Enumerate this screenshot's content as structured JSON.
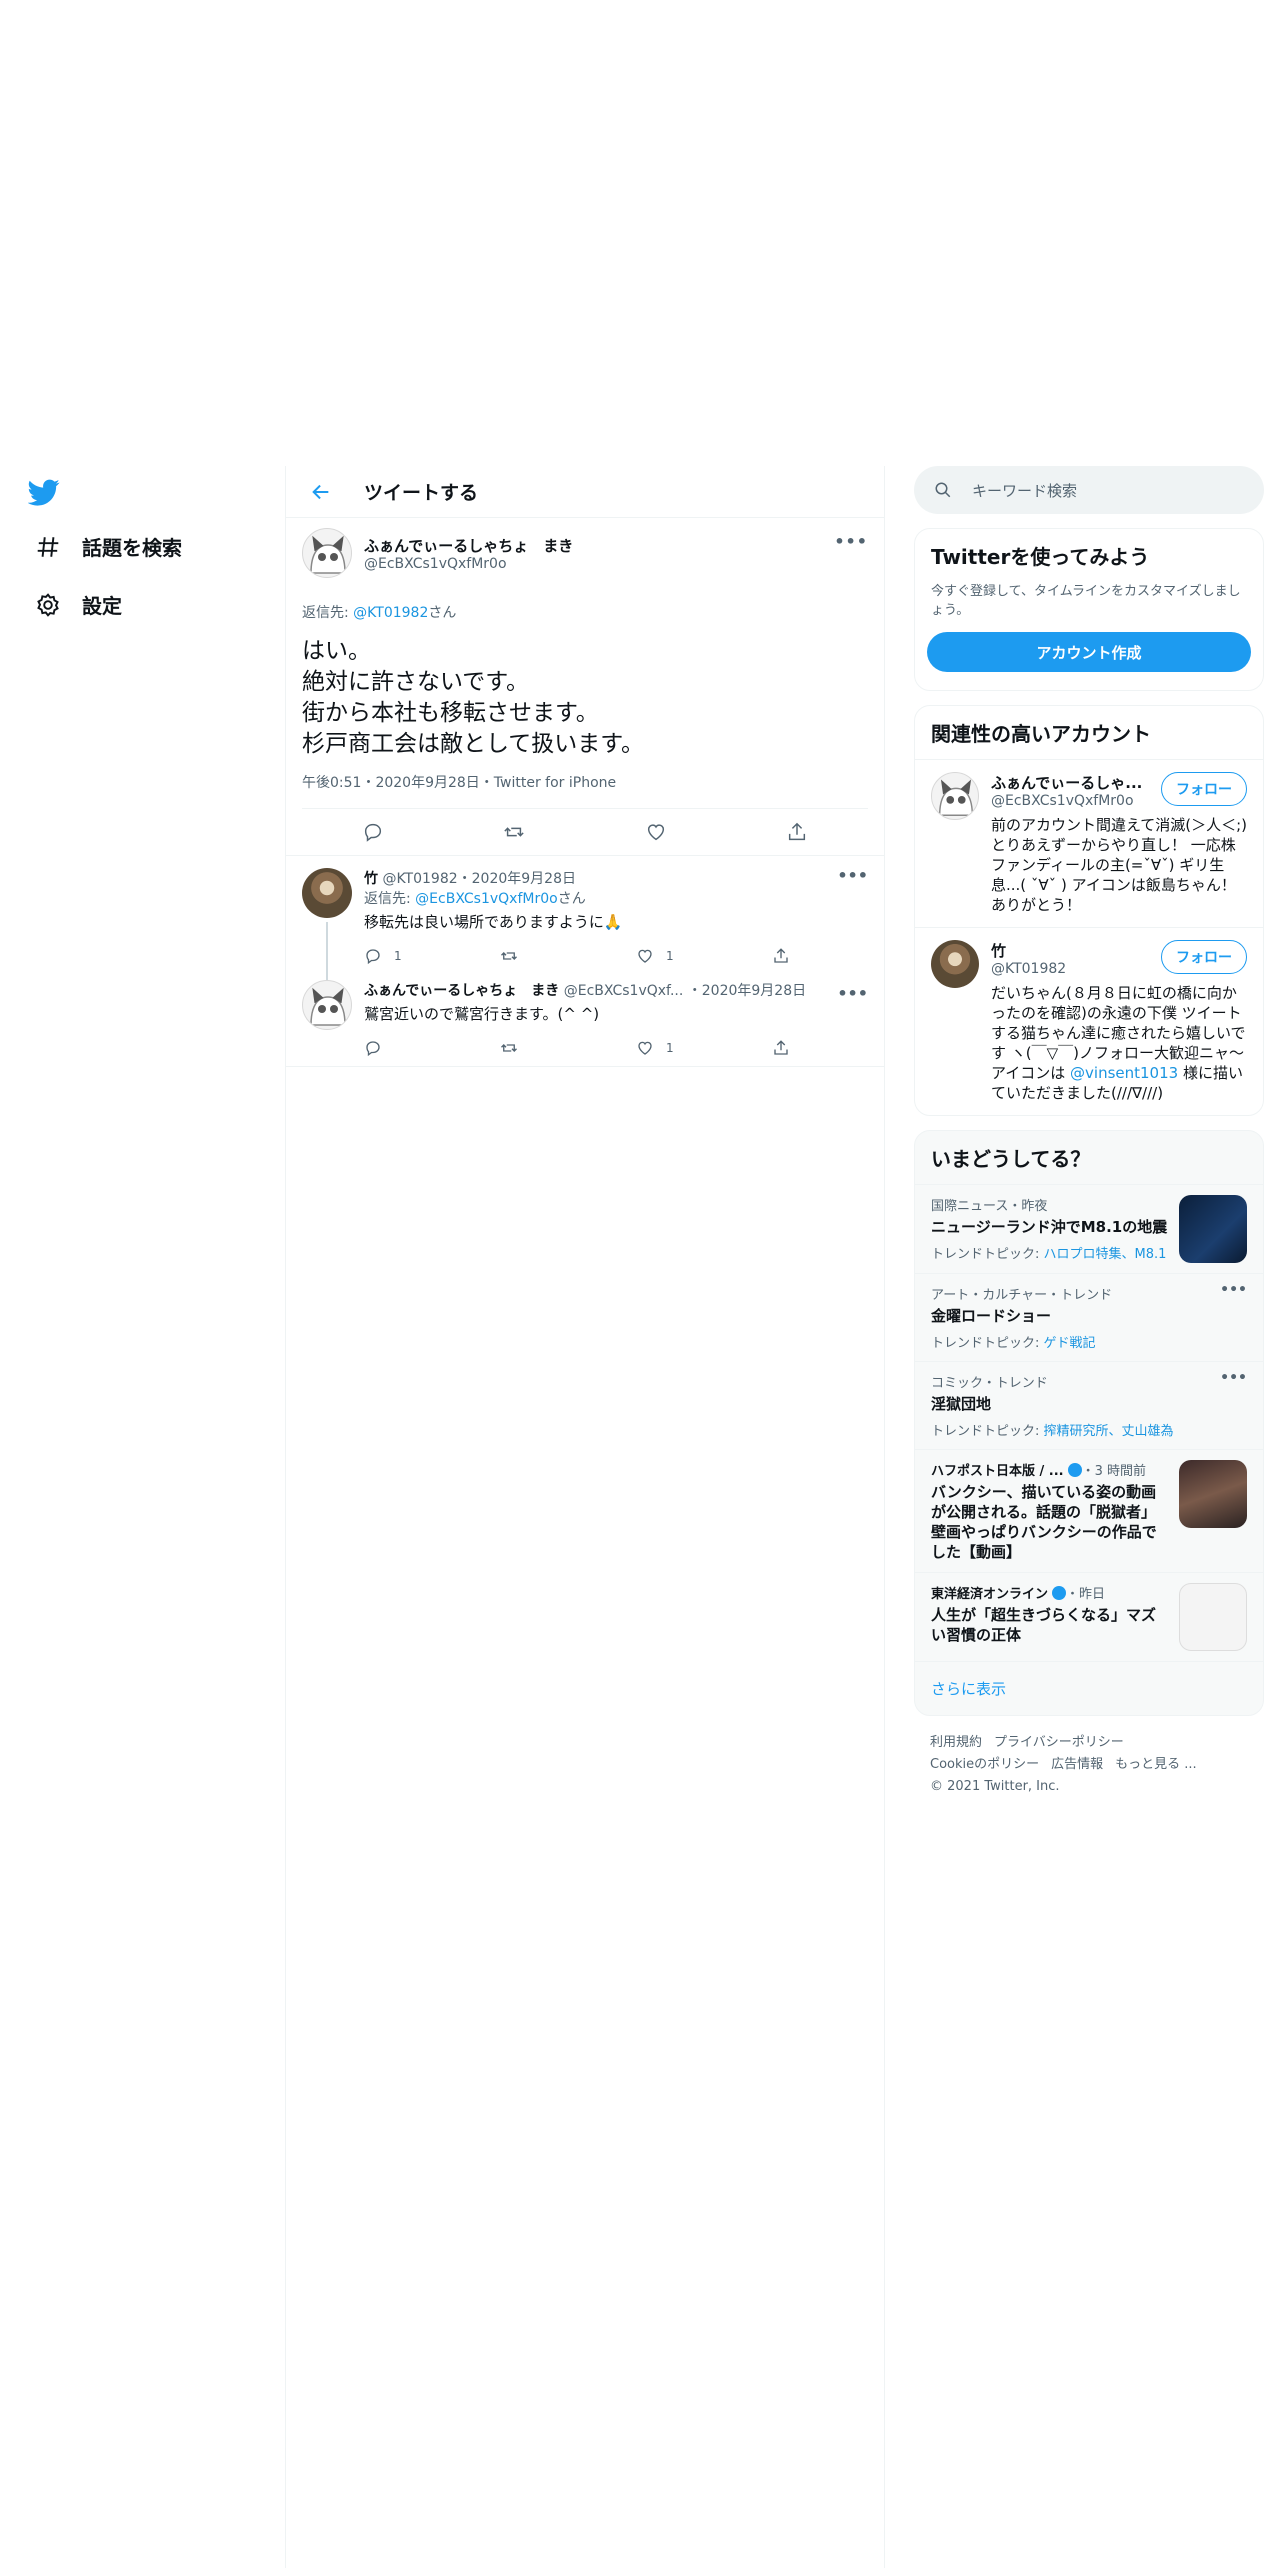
{
  "nav": {
    "explore_label": "話題を検索",
    "settings_label": "設定"
  },
  "header": {
    "title": "ツイートする"
  },
  "main_tweet": {
    "display_name": "ふぁんでぃーるしゃちょ　まき",
    "username": "@EcBXCs1vQxfMr0o",
    "reply_prefix": "返信先: ",
    "reply_to": "@KT01982",
    "reply_suffix": "さん",
    "text": "はい。\n絶対に許さないです。\n街から本社も移転させます。\n杉戸商工会は敵として扱います。",
    "meta": "午後0:51・2020年9月28日・Twitter for iPhone"
  },
  "replies": [
    {
      "display_name": "竹",
      "username_date": "@KT01982・2020年9月28日",
      "reply_prefix": "返信先: ",
      "reply_to": "@EcBXCs1vQxfMr0o",
      "reply_suffix": "さん",
      "text": "移転先は良い場所でありますように🙏",
      "reply_count": "1",
      "like_count": "1"
    },
    {
      "display_name": "ふぁんでぃーるしゃちょ　まき",
      "username_date": "@EcBXCs1vQxf...",
      "date": "・2020年9月28日",
      "text": "鷲宮近いので鷲宮行きます。(^ ^)",
      "reply_count": "",
      "like_count": "1"
    }
  ],
  "search": {
    "placeholder": "キーワード検索"
  },
  "promo": {
    "title": "Twitterを使ってみよう",
    "text": "今すぐ登録して、タイムラインをカスタマイズしましょう。",
    "button": "アカウント作成"
  },
  "related": {
    "title": "関連性の高いアカウント",
    "follow_label": "フォロー",
    "accounts": [
      {
        "display_name": "ふぁんでぃーるしゃ...",
        "username": "@EcBXCs1vQxfMr0o",
        "bio": "前のアカウント間違えて消滅(＞人＜;)とりあえずーからやり直し！ 一応株ファンディールの主(=ˇ∀ˇ) ギリ生息...( ˇ∀ˇ ) アイコンは飯島ちゃん！ありがとう！"
      },
      {
        "display_name": "竹",
        "username": "@KT01982",
        "bio_1": "だいちゃん(８月８日に虹の橋に向かったのを確認)の永遠の下僕 ツイートする猫ちゃん達に癒されたら嬉しいです ヽ(￣▽￣)ノフォロー大歓迎ニャ～ アイコンは ",
        "bio_link": "@vinsent1013",
        "bio_2": " 様に描いていただきました(///∇///)"
      }
    ]
  },
  "trends": {
    "title": "いまどうしてる？",
    "items": [
      {
        "meta": "国際ニュース・昨夜",
        "title": "ニュージーランド沖でM8.1の地震",
        "sub_prefix": "トレンドトピック: ",
        "sub_link": "ハロプロ特集、M8.1"
      },
      {
        "meta": "アート・カルチャー・トレンド",
        "title": "金曜ロードショー",
        "sub_prefix": "トレンドトピック: ",
        "sub_link": "ゲド戦記"
      },
      {
        "meta": "コミック・トレンド",
        "title": "淫獄団地",
        "sub_prefix": "トレンドトピック: ",
        "sub_link": "搾精研究所、丈山雄為"
      },
      {
        "meta_source": "ハフポスト日本版 / ...",
        "meta_time": "・3 時間前",
        "title": "バンクシー、描いている姿の動画が公開される。話題の「脱獄者」壁画やっぱりバンクシーの作品でした【動画】"
      },
      {
        "meta_source": "東洋経済オンライン",
        "meta_time": "・昨日",
        "title": "人生が「超生きづらくなる」マズい習慣の正体"
      }
    ],
    "show_more": "さらに表示"
  },
  "footer": {
    "terms": "利用規約",
    "privacy": "プライバシーポリシー",
    "cookie": "Cookieのポリシー",
    "ads": "広告情報",
    "more": "もっと見る ...",
    "copyright": "© 2021 Twitter, Inc."
  },
  "colors": {
    "accent": "#1d9bf0",
    "link": "#1b95e0",
    "muted": "#536471",
    "border": "#eff3f4"
  },
  "icons": [
    "twitter-logo-icon",
    "hashtag-icon",
    "gear-icon",
    "back-arrow-icon",
    "more-icon",
    "reply-icon",
    "retweet-icon",
    "like-icon",
    "share-icon",
    "search-icon",
    "verified-icon"
  ]
}
